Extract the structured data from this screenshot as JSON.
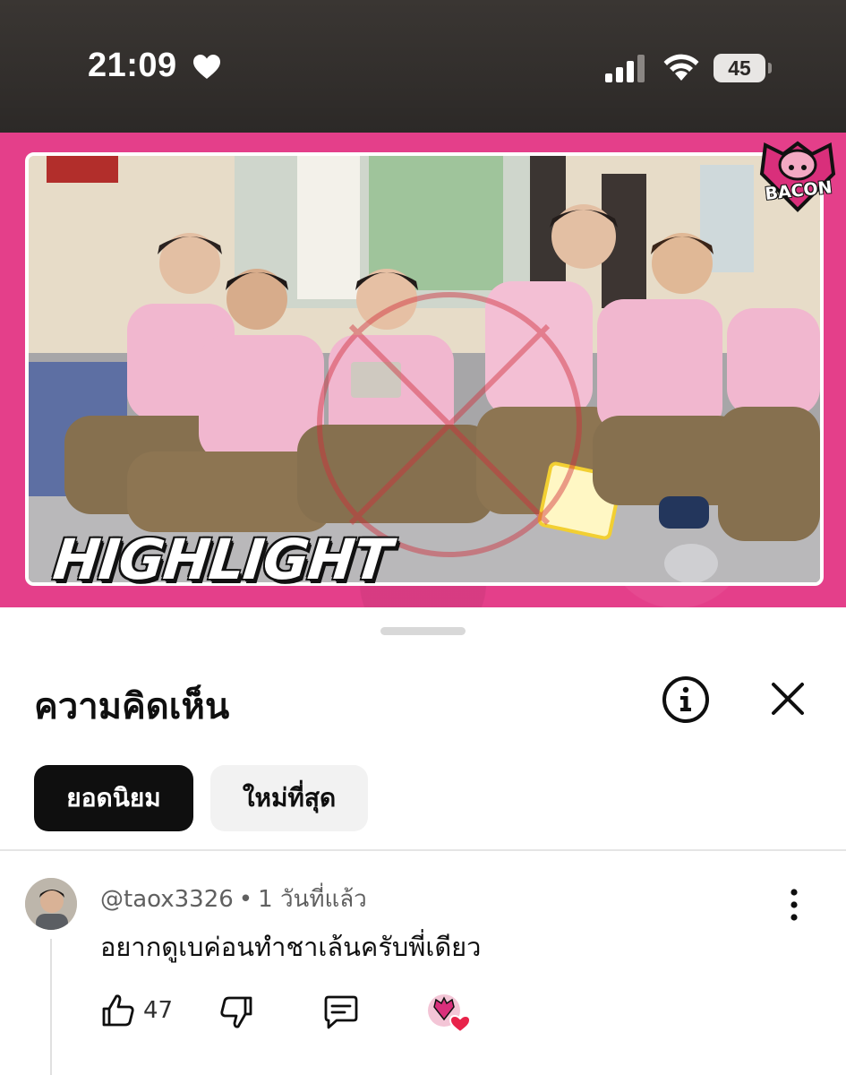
{
  "status_bar": {
    "time": "21:09",
    "battery": "45",
    "icons": [
      "heart-icon",
      "signal-icon",
      "wifi-icon",
      "battery-icon"
    ]
  },
  "video": {
    "overlay_text": "HIGHLIGHT",
    "channel_logo_text": "BACON",
    "accent_color": "#e43f8a"
  },
  "comments": {
    "title": "ความคิดเห็น",
    "icons": [
      "info-icon",
      "close-icon"
    ],
    "sort_chips": [
      {
        "label": "ยอดนิยม",
        "selected": true
      },
      {
        "label": "ใหม่ที่สุด",
        "selected": false
      }
    ],
    "items": [
      {
        "author": "@taox3326",
        "time_ago": "1 วันที่แล้ว",
        "text": "อยากดูเบค่อนทำชาเล้นครับพี่เดียว",
        "like_count": "47",
        "creator_hearted": true
      }
    ]
  }
}
